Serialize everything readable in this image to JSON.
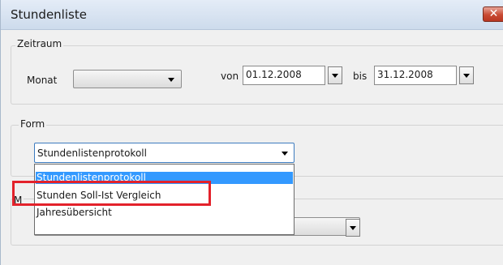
{
  "window": {
    "title": "Stundenliste",
    "close_glyph": "✕"
  },
  "zeitraum": {
    "legend": "Zeitraum",
    "monat_label": "Monat",
    "monat_value": "",
    "von_label": "von",
    "von_value": "01.12.2008",
    "bis_label": "bis",
    "bis_value": "31.12.2008"
  },
  "form": {
    "legend": "Form",
    "selected": "Stundenlistenprotokoll",
    "options": [
      "Stundenlistenprotokoll",
      "Stunden Soll-Ist Vergleich",
      "Jahresübersicht"
    ],
    "highlighted_option": "Stunden Soll-Ist Vergleich"
  },
  "lower_group": {
    "legend_partial": "M"
  },
  "colors": {
    "accent": "#3399ff",
    "highlight": "#e3222b"
  }
}
